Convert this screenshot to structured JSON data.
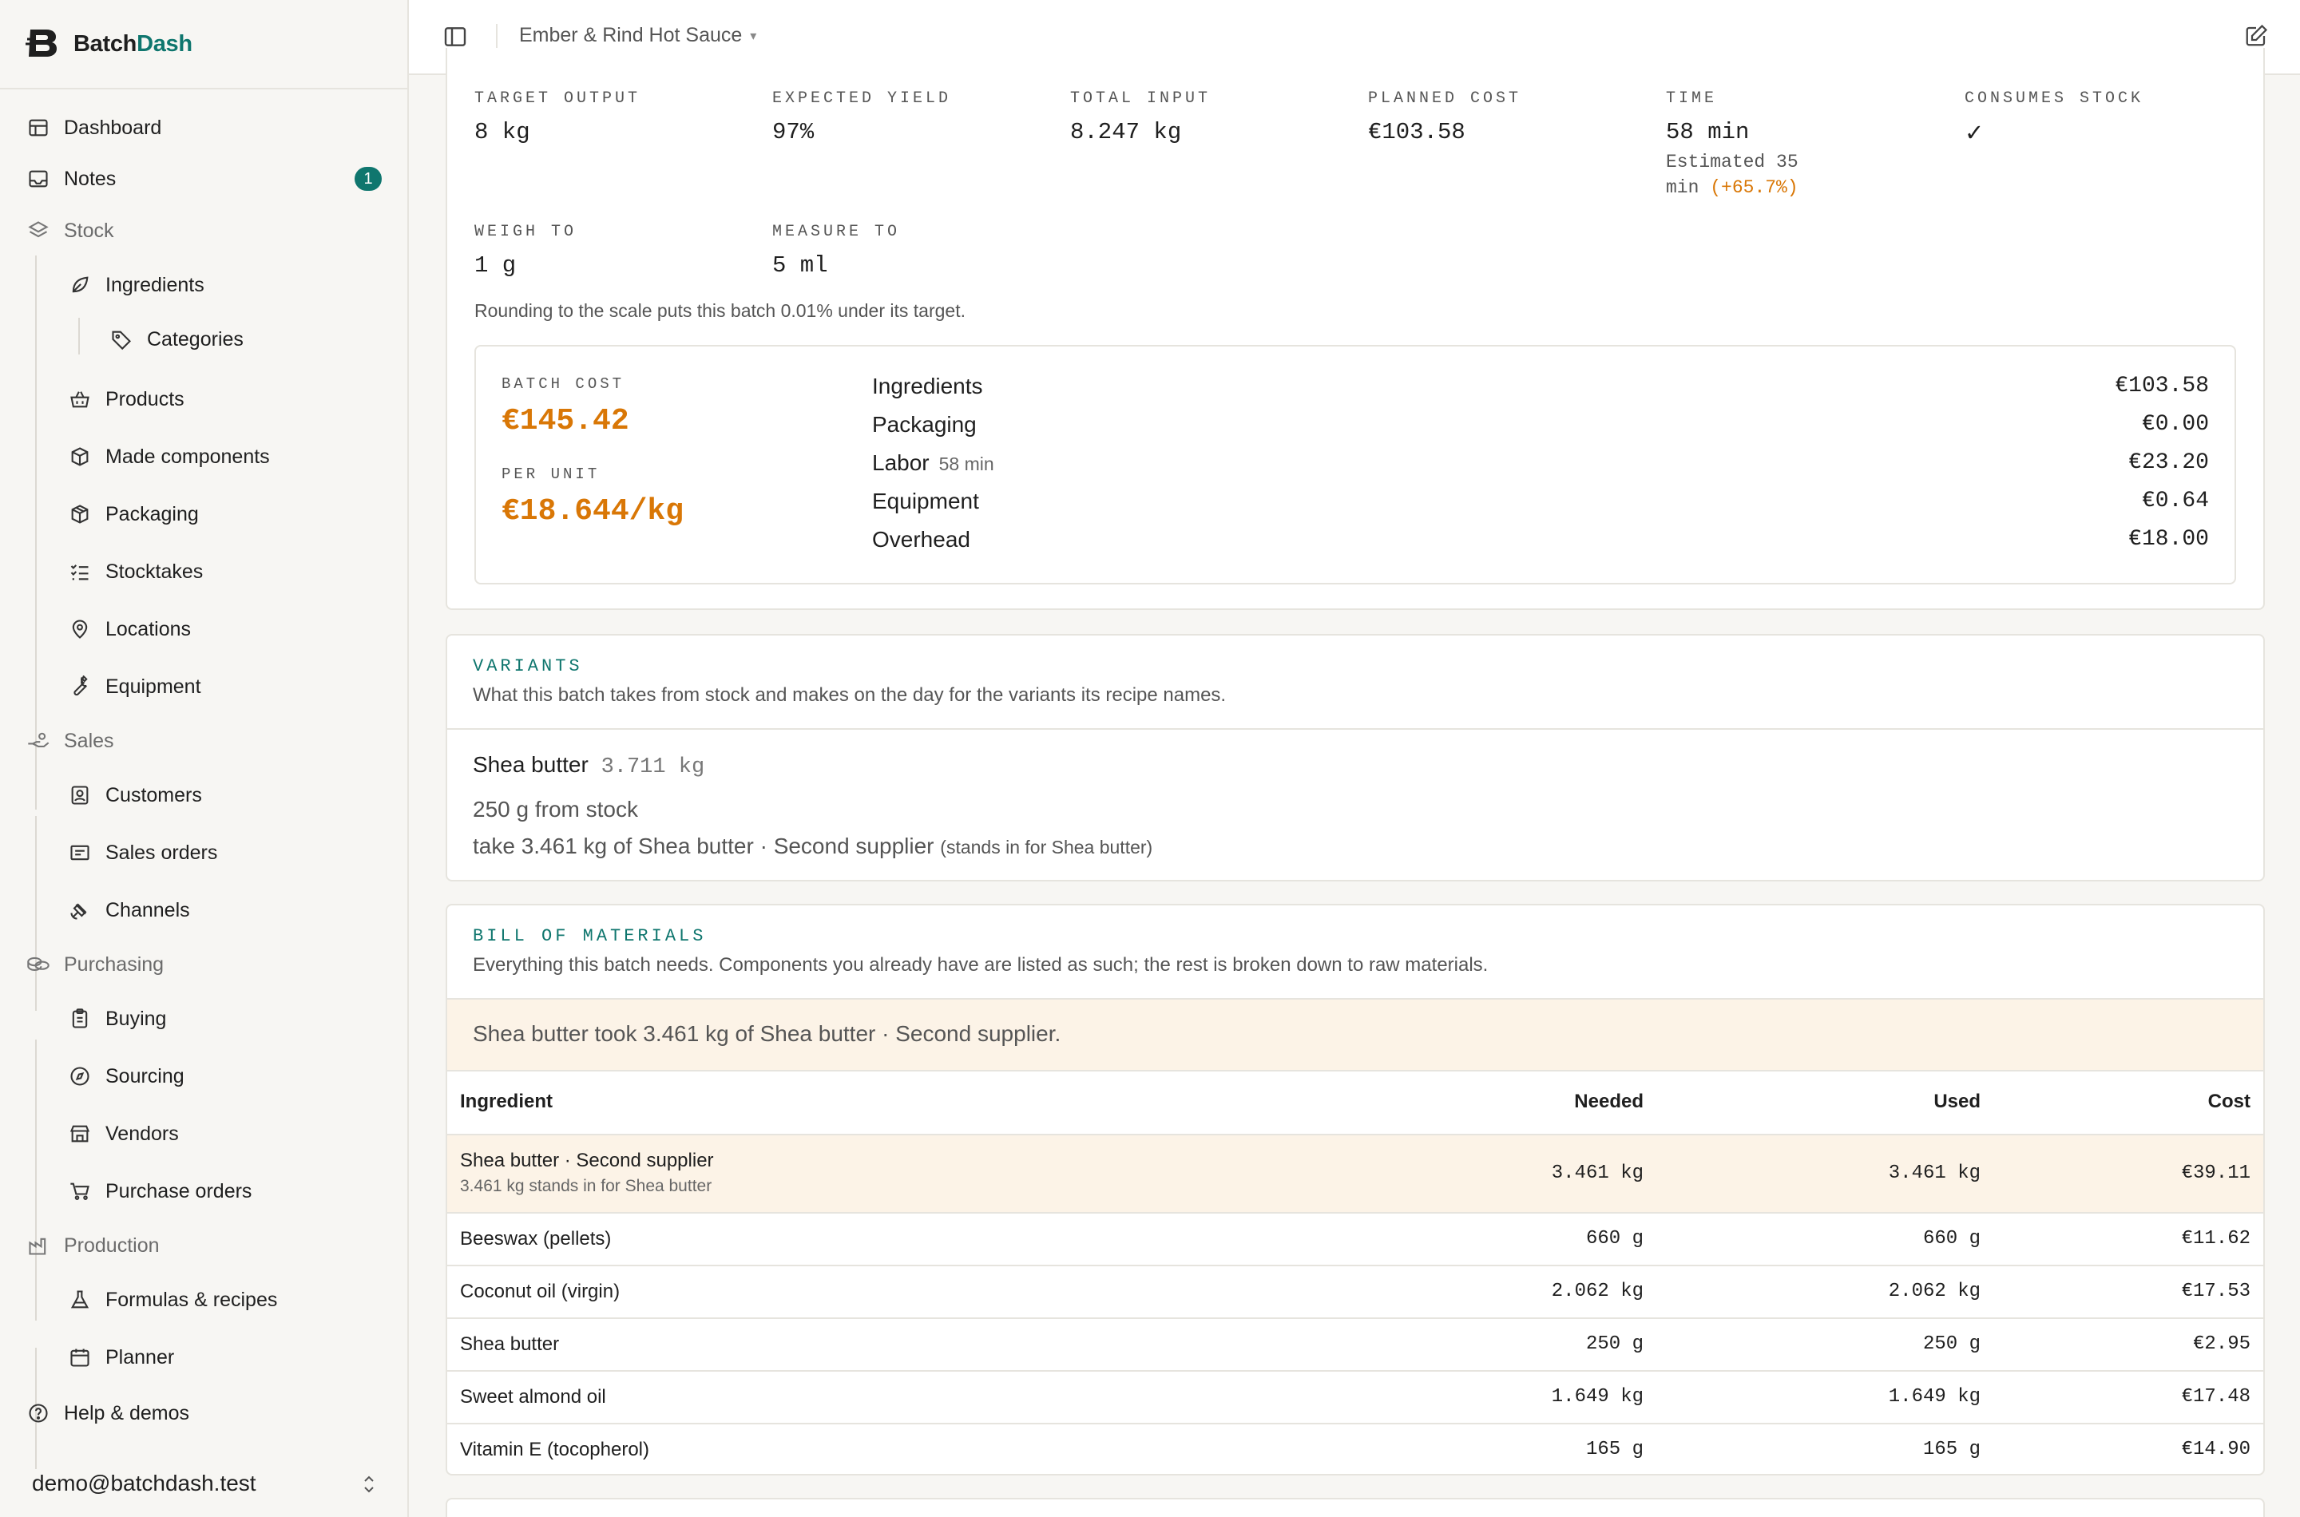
{
  "app": {
    "brand_prefix": "Batch",
    "brand_suffix": "Dash",
    "brand_color": "#0f766e",
    "accent": "#d97706"
  },
  "sidebar": {
    "items": [
      {
        "label": "Dashboard",
        "icon": "layout-icon"
      },
      {
        "label": "Notes",
        "icon": "inbox-icon",
        "badge": "1"
      },
      {
        "label": "Stock",
        "icon": "layers-icon"
      },
      {
        "label": "Ingredients",
        "icon": "leaf-icon"
      },
      {
        "label": "Categories",
        "icon": "tag-icon"
      },
      {
        "label": "Products",
        "icon": "basket-icon"
      },
      {
        "label": "Made components",
        "icon": "box-icon"
      },
      {
        "label": "Packaging",
        "icon": "package-icon"
      },
      {
        "label": "Stocktakes",
        "icon": "checklist-icon"
      },
      {
        "label": "Locations",
        "icon": "map-pin-icon"
      },
      {
        "label": "Equipment",
        "icon": "wrench-icon"
      },
      {
        "label": "Sales",
        "icon": "hand-coins-icon"
      },
      {
        "label": "Customers",
        "icon": "contact-icon"
      },
      {
        "label": "Sales orders",
        "icon": "receipt-icon"
      },
      {
        "label": "Channels",
        "icon": "satellite-icon"
      },
      {
        "label": "Purchasing",
        "icon": "coins-icon"
      },
      {
        "label": "Buying",
        "icon": "clipboard-icon"
      },
      {
        "label": "Sourcing",
        "icon": "compass-icon"
      },
      {
        "label": "Vendors",
        "icon": "store-icon"
      },
      {
        "label": "Purchase orders",
        "icon": "cart-icon"
      },
      {
        "label": "Production",
        "icon": "factory-icon"
      },
      {
        "label": "Formulas & recipes",
        "icon": "flask-icon"
      },
      {
        "label": "Planner",
        "icon": "calendar-icon"
      },
      {
        "label": "Help & demos",
        "icon": "help-icon"
      }
    ],
    "user_email": "demo@batchdash.test"
  },
  "topbar": {
    "title": "Ember & Rind Hot Sauce",
    "caret": "▾"
  },
  "summary": {
    "target_output": {
      "label": "TARGET OUTPUT",
      "value": "8 kg"
    },
    "expected_yield": {
      "label": "EXPECTED YIELD",
      "value": "97%"
    },
    "total_input": {
      "label": "TOTAL INPUT",
      "value": "8.247 kg"
    },
    "planned_cost": {
      "label": "PLANNED COST",
      "value": "€103.58"
    },
    "time": {
      "label": "TIME",
      "value": "58 min",
      "estimate_a": "Estimated 35",
      "estimate_b": "min",
      "delta": "(+65.7%)"
    },
    "consumes_stock": {
      "label": "CONSUMES STOCK",
      "value": "✓"
    },
    "weigh_to": {
      "label": "WEIGH TO",
      "value": "1 g"
    },
    "measure_to": {
      "label": "MEASURE TO",
      "value": "5 ml"
    },
    "rounding_note": "Rounding to the scale puts this batch 0.01% under its target."
  },
  "batch_cost": {
    "label": "BATCH COST",
    "value": "€145.42",
    "per_unit_label": "PER UNIT",
    "per_unit_value": "€18.644/kg",
    "rows": [
      {
        "label": "Ingredients",
        "sub": "",
        "value": "€103.58"
      },
      {
        "label": "Packaging",
        "sub": "",
        "value": "€0.00"
      },
      {
        "label": "Labor",
        "sub": "58 min",
        "value": "€23.20"
      },
      {
        "label": "Equipment",
        "sub": "",
        "value": "€0.64"
      },
      {
        "label": "Overhead",
        "sub": "",
        "value": "€18.00"
      }
    ]
  },
  "variants": {
    "title": "VARIANTS",
    "desc": "What this batch takes from stock and makes on the day for the variants its recipe names.",
    "name": "Shea butter",
    "qty": "3.711 kg",
    "from_stock": "250 g from stock",
    "take": "take 3.461 kg of Shea butter · Second supplier",
    "stands_in": "(stands in for Shea butter)"
  },
  "bom": {
    "title": "BILL OF MATERIALS",
    "desc": "Everything this batch needs. Components you already have are listed as such; the rest is broken down to raw materials.",
    "banner": "Shea butter took 3.461 kg of Shea butter · Second supplier.",
    "headers": {
      "ingredient": "Ingredient",
      "needed": "Needed",
      "used": "Used",
      "cost": "Cost"
    },
    "rows": [
      {
        "name": "Shea butter · Second supplier",
        "sub": "3.461 kg stands in for Shea butter",
        "needed": "3.461 kg",
        "used": "3.461 kg",
        "cost": "€39.11"
      },
      {
        "name": "Beeswax (pellets)",
        "sub": "",
        "needed": "660 g",
        "used": "660 g",
        "cost": "€11.62"
      },
      {
        "name": "Coconut oil (virgin)",
        "sub": "",
        "needed": "2.062 kg",
        "used": "2.062 kg",
        "cost": "€17.53"
      },
      {
        "name": "Shea butter",
        "sub": "",
        "needed": "250 g",
        "used": "250 g",
        "cost": "€2.95"
      },
      {
        "name": "Sweet almond oil",
        "sub": "",
        "needed": "1.649 kg",
        "used": "1.649 kg",
        "cost": "€17.48"
      },
      {
        "name": "Vitamin E (tocopherol)",
        "sub": "",
        "needed": "165 g",
        "used": "165 g",
        "cost": "€14.90"
      }
    ]
  }
}
